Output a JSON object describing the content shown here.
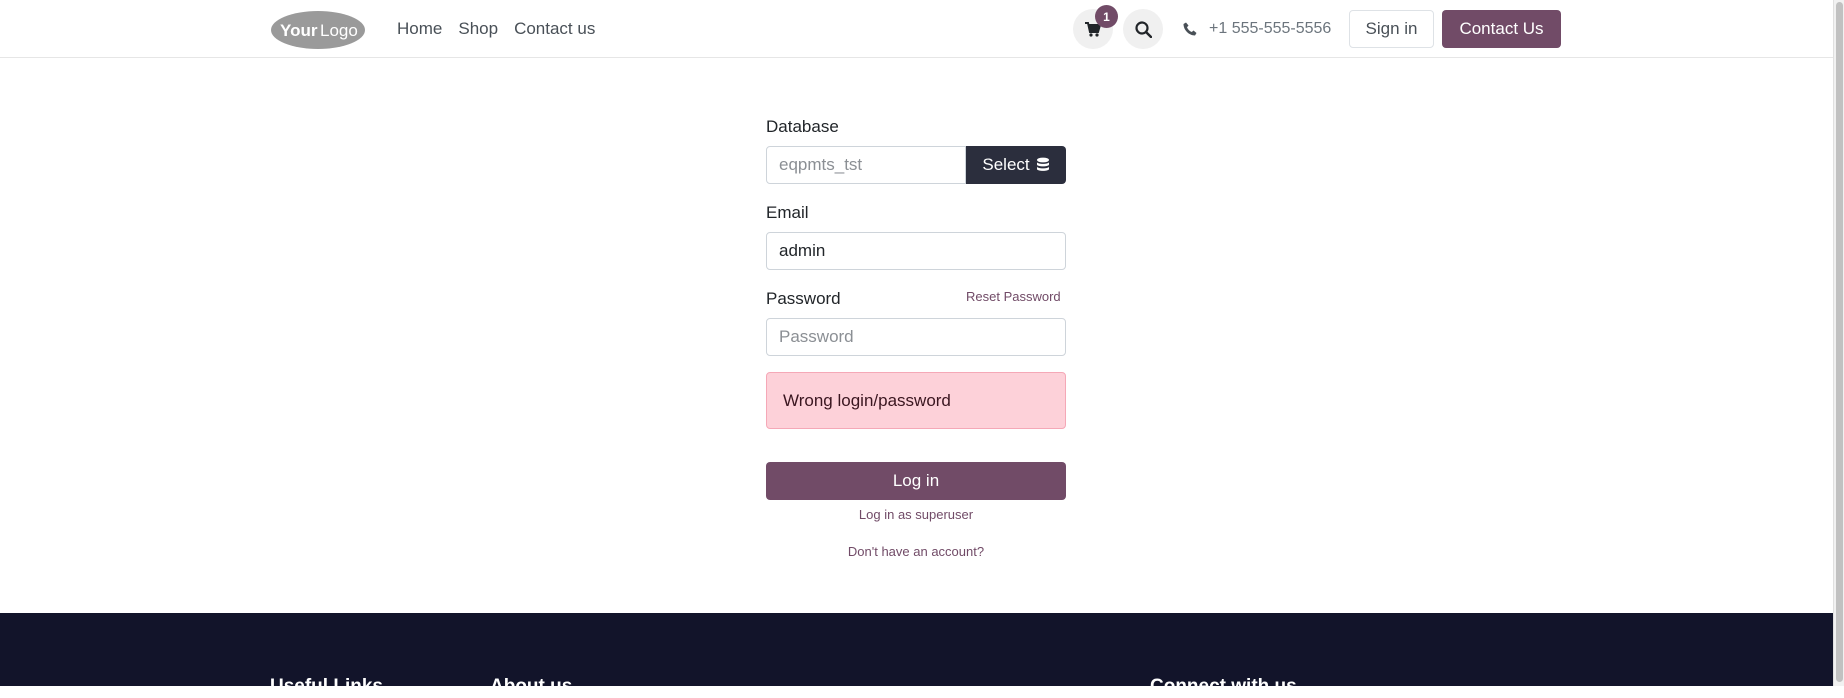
{
  "header": {
    "logo_text_bold": "Your",
    "logo_text_light": "Logo",
    "nav": [
      {
        "label": "Home"
      },
      {
        "label": "Shop"
      },
      {
        "label": "Contact us"
      }
    ],
    "cart_count": "1",
    "phone": "+1 555-555-5556",
    "sign_in_label": "Sign in",
    "contact_label": "Contact Us"
  },
  "form": {
    "database_label": "Database",
    "database_placeholder": "eqpmts_tst",
    "select_label": "Select",
    "email_label": "Email",
    "email_value": "admin",
    "password_label": "Password",
    "password_placeholder": "Password",
    "reset_password_label": "Reset Password",
    "error_message": "Wrong login/password",
    "login_label": "Log in",
    "superuser_label": "Log in as superuser",
    "signup_label": "Don't have an account?"
  },
  "footer": {
    "headings": [
      "Useful Links",
      "About us",
      "Connect with us"
    ]
  },
  "colors": {
    "brand": "#714B67",
    "dark": "#2b2e3d",
    "footer_bg": "#12142a",
    "alert_bg": "#fdd1d9"
  },
  "icons": [
    "cart-icon",
    "search-icon",
    "phone-icon",
    "database-icon"
  ]
}
